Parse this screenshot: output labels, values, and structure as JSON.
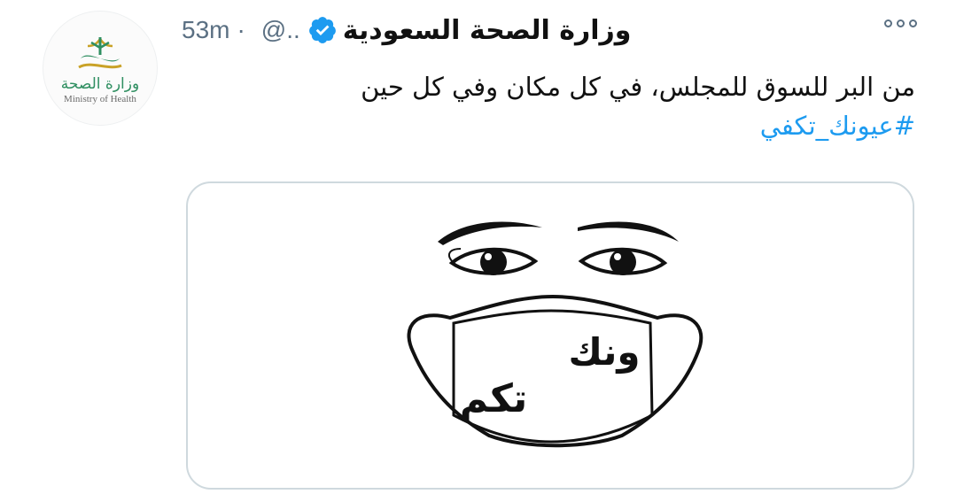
{
  "account": {
    "display_name": "وزارة الصحة السعودية",
    "handle": "@..",
    "time_ago": "53m",
    "separator": "·",
    "verified": true,
    "verified_color": "#1d9bf0"
  },
  "avatar": {
    "logo_text_ar": "وزارة الصحة",
    "logo_text_en": "Ministry of Health",
    "brand_color": "#2f8f61"
  },
  "tweet": {
    "text": "من البر للسوق للمجلس، في كل مكان وفي كل حين",
    "hashtag": "#عيونك_تكفي"
  },
  "media": {
    "mask_text_top": "ونك",
    "mask_text_bottom": "تكم"
  },
  "icons": [
    "verified-badge-icon",
    "more-options-icon"
  ]
}
